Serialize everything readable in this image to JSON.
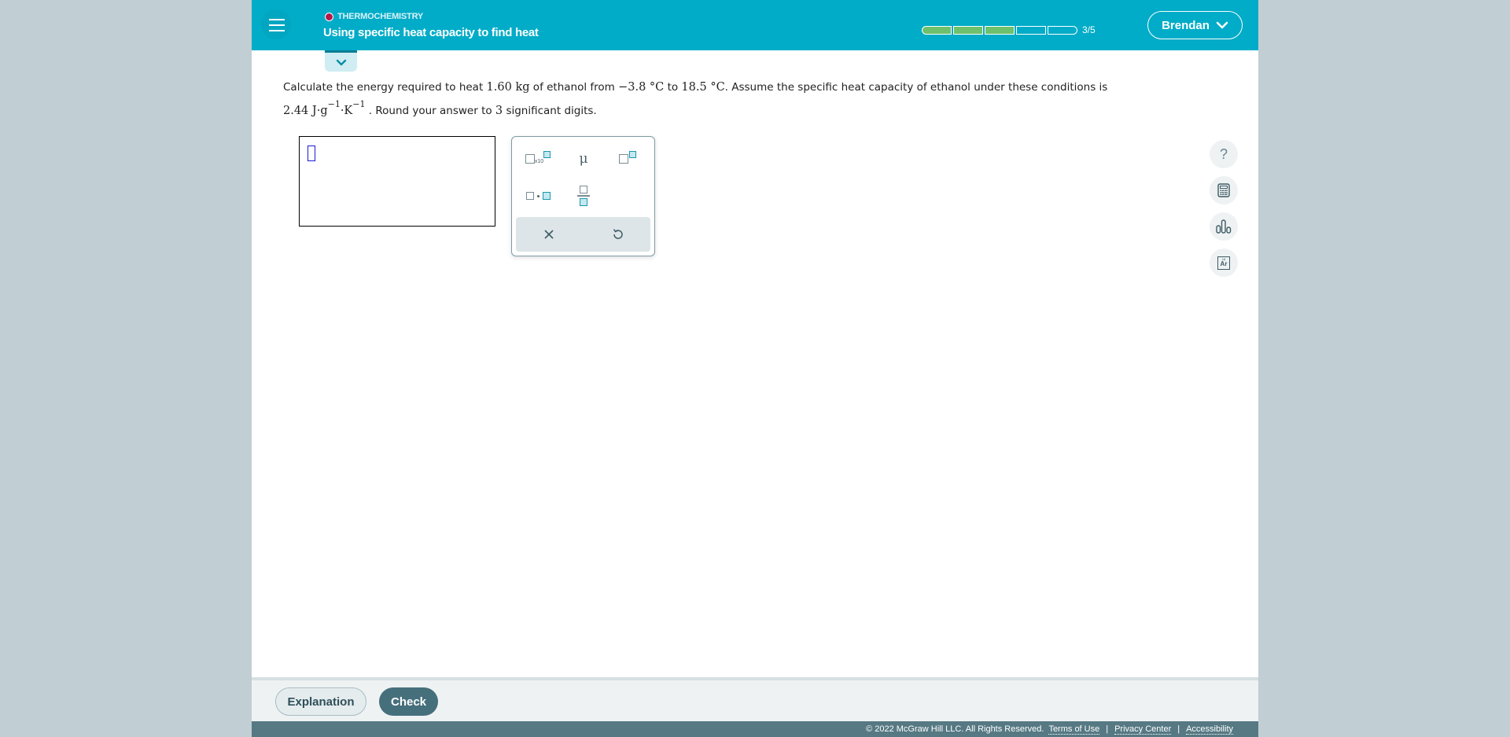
{
  "header": {
    "topic": "THERMOCHEMISTRY",
    "lesson_title": "Using specific heat capacity to find heat",
    "progress": {
      "completed": 3,
      "total": 5,
      "label": "3/5"
    },
    "user_name": "Brendan",
    "colors": {
      "header_bg": "#00acc8",
      "topic_dot": "#b5184a",
      "progress_fill": "#6dc06c"
    }
  },
  "question": {
    "part1": "Calculate the energy required to heat ",
    "mass": "1.60 kg",
    "part2": " of ethanol from ",
    "temp_start": "−3.8 °C",
    "part3": " to ",
    "temp_end": "18.5 °C",
    "part4": ". Assume the specific heat capacity of ethanol under these conditions is ",
    "heat_capacity_value": "2.44 J·g",
    "exp1": "−1",
    "unit_k": "·K",
    "exp2": "−1",
    "part5": " . Round your answer to ",
    "sig_figs": "3",
    "part6": " significant digits."
  },
  "answer": {
    "value": ""
  },
  "keypad": {
    "keys": [
      {
        "name": "scientific-notation",
        "label": "x10"
      },
      {
        "name": "micro",
        "label": "μ"
      },
      {
        "name": "superscript",
        "label": ""
      },
      {
        "name": "multiply-dot",
        "label": ""
      },
      {
        "name": "fraction",
        "label": ""
      }
    ],
    "clear_label": "×",
    "undo_label": "↺"
  },
  "side_tools": [
    {
      "name": "help",
      "label": "?"
    },
    {
      "name": "calculator"
    },
    {
      "name": "data-chart"
    },
    {
      "name": "periodic-table",
      "label": "Ar",
      "number": "18"
    }
  ],
  "actions": {
    "explanation_label": "Explanation",
    "check_label": "Check"
  },
  "footer": {
    "copyright": "© 2022 McGraw Hill LLC. All Rights Reserved.",
    "links": [
      "Terms of Use",
      "Privacy Center",
      "Accessibility"
    ],
    "separator": "|"
  }
}
